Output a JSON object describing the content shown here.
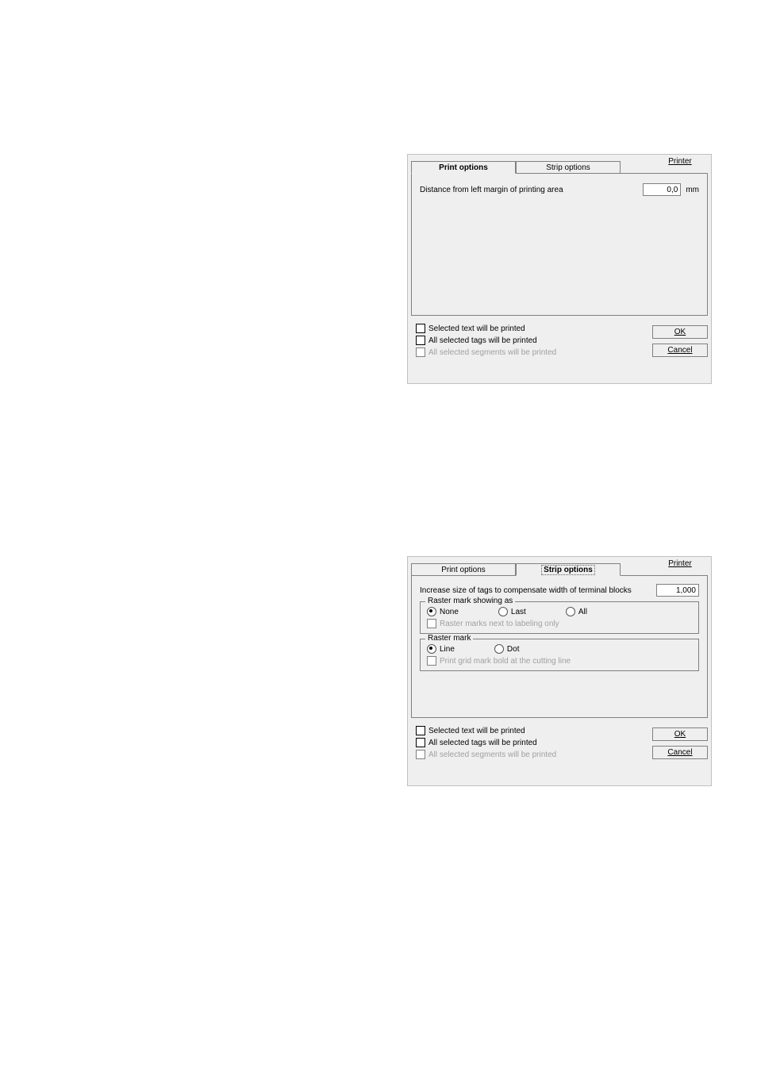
{
  "dialog1": {
    "tabs": {
      "print": "Print options",
      "strip": "Strip options"
    },
    "printer_link": "Printer",
    "distance_label": "Distance from left margin of printing area",
    "distance_value": "0,0",
    "distance_unit": "mm",
    "checks": {
      "sel_text": "Selected text will be printed",
      "all_tags": "All selected tags will be printed",
      "all_segments": "All selected segments will be printed"
    },
    "buttons": {
      "ok": "OK",
      "cancel": "Cancel"
    }
  },
  "dialog2": {
    "tabs": {
      "print": "Print options",
      "strip": "Strip options"
    },
    "printer_link": "Printer",
    "increase_label": "Increase size of tags to compensate width of terminal blocks",
    "increase_value": "1,000",
    "group_showing": {
      "legend": "Raster mark showing as",
      "none": "None",
      "last": "Last",
      "all": "All",
      "next_label": "Raster marks next to labeling only"
    },
    "group_raster": {
      "legend": "Raster mark",
      "line": "Line",
      "dot": "Dot",
      "bold_label": "Print grid mark bold at the cutting line"
    },
    "checks": {
      "sel_text": "Selected text will be printed",
      "all_tags": "All selected tags will be printed",
      "all_segments": "All selected segments will be printed"
    },
    "buttons": {
      "ok": "OK",
      "cancel": "Cancel"
    }
  }
}
